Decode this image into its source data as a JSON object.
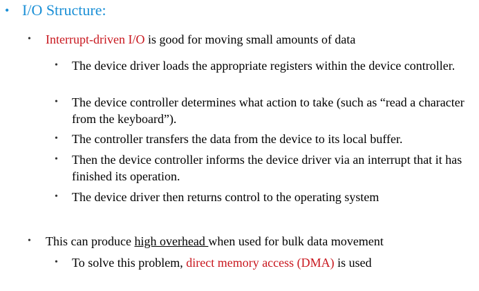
{
  "colors": {
    "heading": "#1a8fd6",
    "highlight": "#c8161d",
    "body": "#000000"
  },
  "bullet_glyph": "•",
  "heading": "I/O Structure:",
  "point1": {
    "highlight": "Interrupt-driven I/O",
    "rest": " is good for moving small amounts of data",
    "subpoints": [
      "The device driver loads the appropriate registers within the device controller.",
      "The device controller determines what action to take (such as “read a character from the keyboard”).",
      "The controller transfers the data from the device to its local buffer.",
      "Then the device controller informs the device driver via an interrupt that it has finished its operation.",
      "The device driver then returns control to the operating system"
    ]
  },
  "point2": {
    "before": "This can produce ",
    "underlined": "high overhead ",
    "after": "when used for bulk data movement",
    "subpoint": {
      "before": "To solve this problem, ",
      "highlight": "direct memory access (DMA)",
      "after": " is used"
    }
  }
}
